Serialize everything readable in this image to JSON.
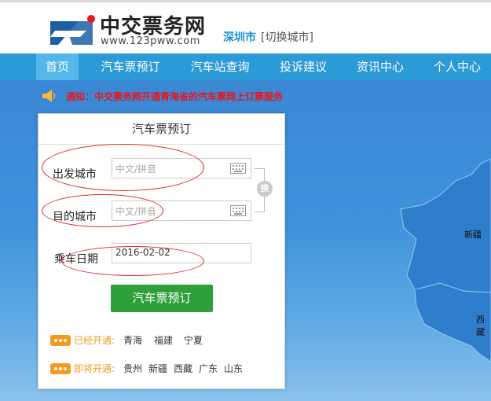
{
  "brand": {
    "title": "中交票务网",
    "url": "www.123pww.com",
    "city": "深圳市",
    "switch_city": "[切换城市]"
  },
  "nav": {
    "items": [
      "首页",
      "汽车票预订",
      "汽车站查询",
      "投诉建议",
      "资讯中心",
      "个人中心"
    ],
    "active_index": 0
  },
  "notice": {
    "text": "通知：中交票务网开通青海省的汽车票网上订票服务"
  },
  "booking": {
    "title": "汽车票预订",
    "from_label": "出发城市",
    "from_placeholder": "中文/拼音",
    "to_label": "目的城市",
    "to_placeholder": "中文/拼音",
    "swap_label": "换",
    "date_label": "乘车日期",
    "date_value": "2016-02-02",
    "submit_label": "汽车票预订",
    "opened_label": "已经开通:",
    "opened_provinces": [
      "青海",
      "福建",
      "宁夏"
    ],
    "soon_label": "即将开通:",
    "soon_provinces": [
      "贵州",
      "新疆",
      "西藏",
      "广东",
      "山东"
    ]
  },
  "map": {
    "labels": [
      "新疆",
      "西藏"
    ]
  },
  "colors": {
    "nav_bg": "#2b9ad7",
    "nav_active": "#54b7ea",
    "notice_text": "#e8151c",
    "submit_bg": "#2da039",
    "badge": "#f39a1f",
    "annotation": "#e3272c"
  }
}
